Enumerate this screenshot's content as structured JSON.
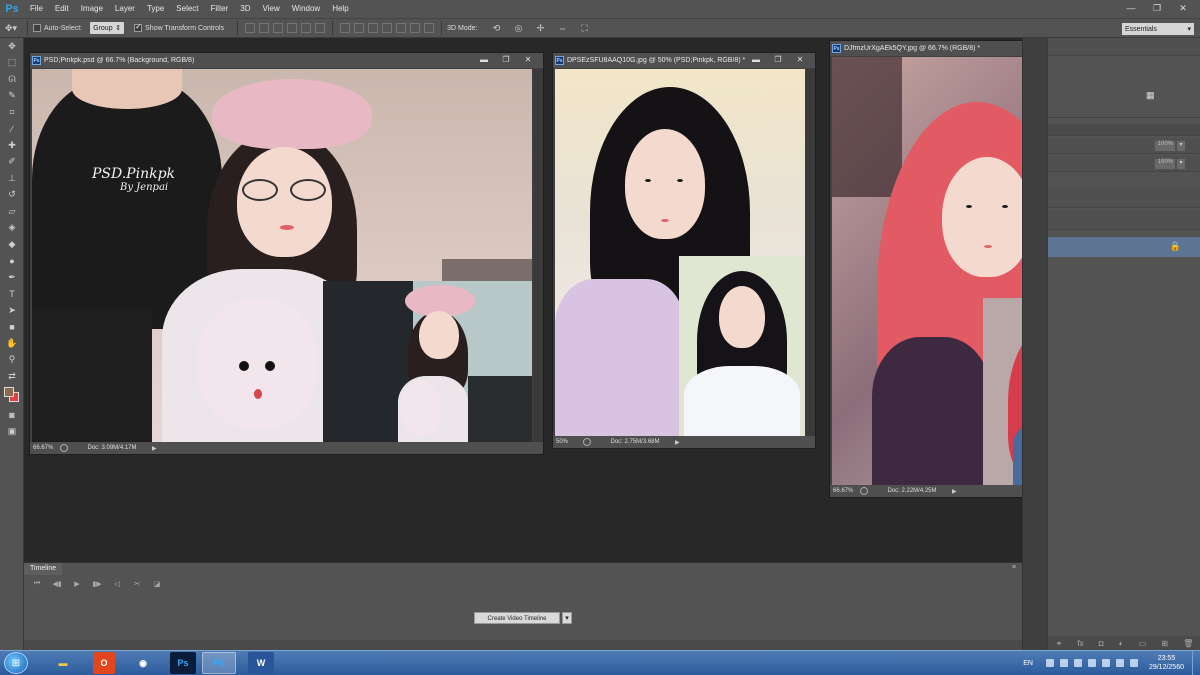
{
  "app": {
    "logo": "Ps",
    "menu": [
      "File",
      "Edit",
      "Image",
      "Layer",
      "Type",
      "Select",
      "Filter",
      "3D",
      "View",
      "Window",
      "Help"
    ],
    "window_controls": [
      "—",
      "❐",
      "✕"
    ]
  },
  "options_bar": {
    "auto_select_label": "Auto-Select:",
    "auto_select_checked": false,
    "auto_select_value": "Group",
    "show_transform_label": "Show Transform Controls",
    "show_transform_checked": true,
    "mode_label": "3D Mode:",
    "workspace": "Essentials"
  },
  "documents": [
    {
      "title": "PSD;Pinkpk.psd @ 66.7% (Background, RGB/8)",
      "zoom": "66.67%",
      "doc_info": "Doc: 3.09M/4.17M",
      "watermark_line1": "PSD.Pinkpk",
      "watermark_line2": "By Jenpai"
    },
    {
      "title": "DPSEzSFU8AAQ10G.jpg @ 50% (PSD;Pinkpk, RGB/8) *",
      "zoom": "50%",
      "doc_info": "Doc: 2.75M/3.68M"
    },
    {
      "title": "DJfmzUrXgAEk5QY.jpg @ 66.7% (RGB/8) *",
      "zoom": "66.67%",
      "doc_info": "Doc: 2.22M/4.25M"
    }
  ],
  "right_panel": {
    "opacity_1": "100%",
    "opacity_2": "100%"
  },
  "timeline": {
    "tab": "Timeline",
    "create_button": "Create Video Timeline"
  },
  "taskbar": {
    "language": "EN",
    "time": "23:55",
    "date": "29/12/2560",
    "apps": [
      "explorer",
      "office",
      "chrome",
      "photoshop",
      "photoshop-active",
      "word"
    ]
  },
  "colors": {
    "foreground": "#8b6a4e",
    "background": "#e04040",
    "accent": "#2fa3e8"
  }
}
